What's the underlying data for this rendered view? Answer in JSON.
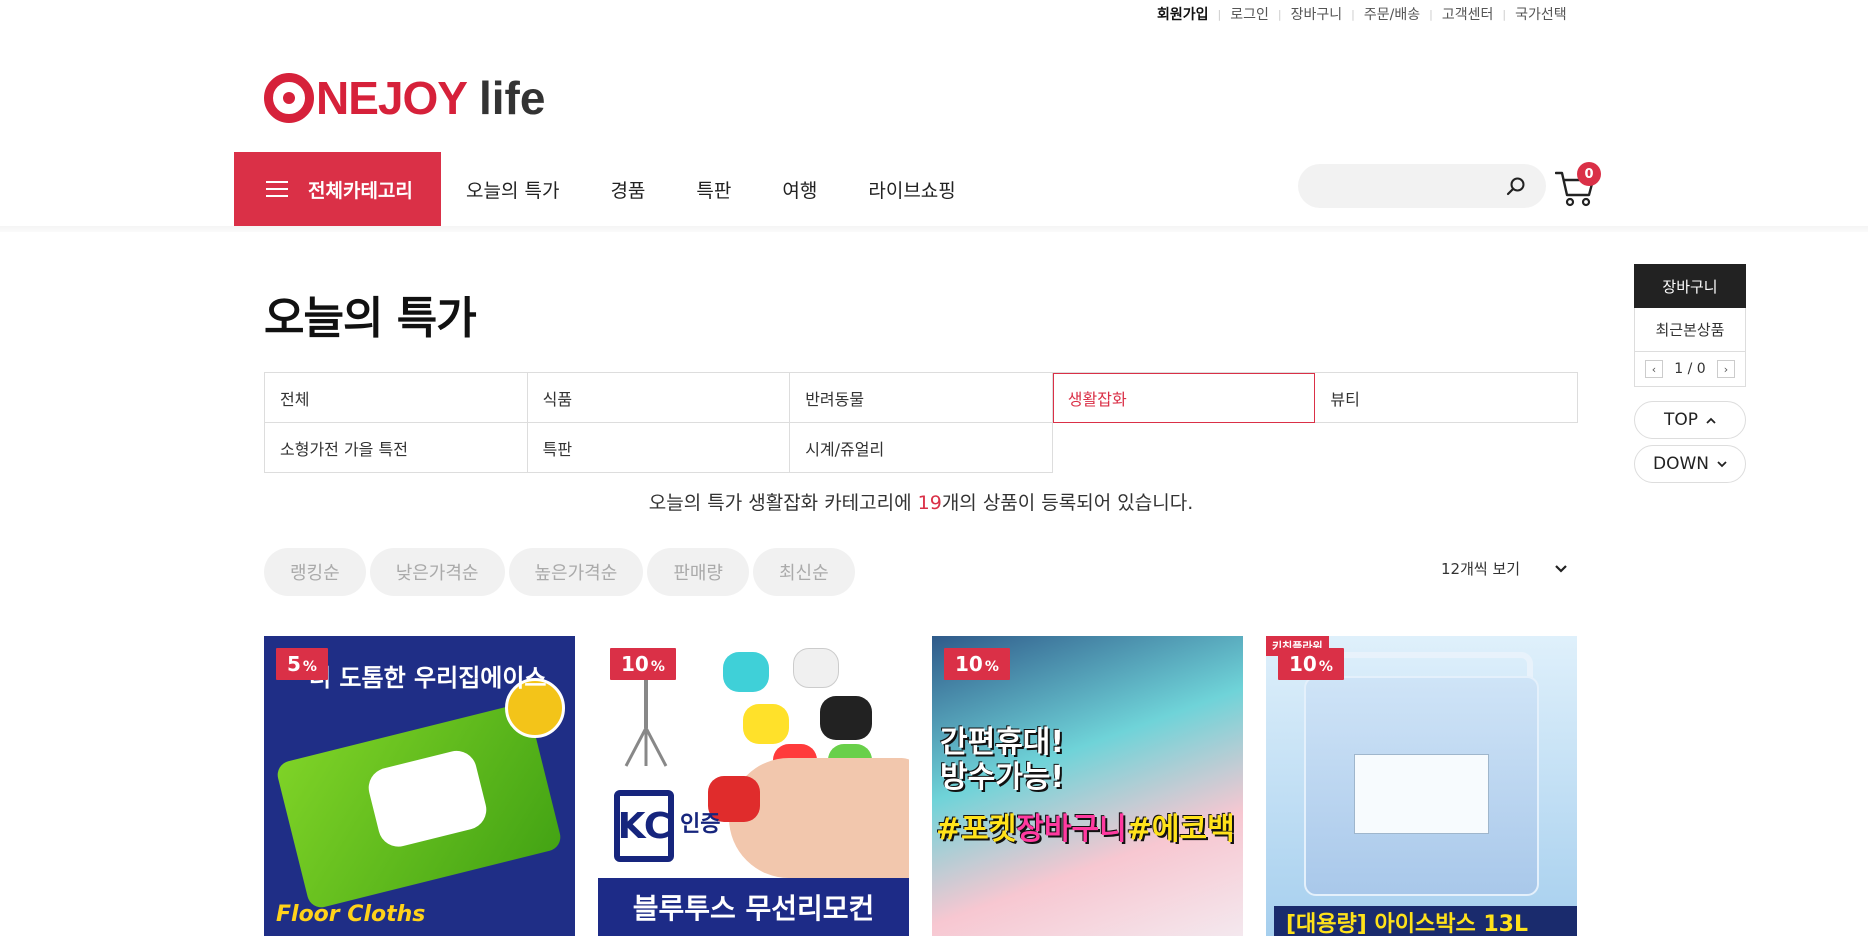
{
  "util": {
    "join": "회원가입",
    "login": "로그인",
    "cart": "장바구니",
    "order": "주문/배송",
    "cs": "고객센터",
    "country": "국가선택"
  },
  "logo": {
    "part1": "NEJOY",
    "part2": "life"
  },
  "gnb": {
    "all_category": "전체카테고리",
    "items": [
      "오늘의 특가",
      "경품",
      "특판",
      "여행",
      "라이브쇼핑"
    ]
  },
  "search": {
    "placeholder": ""
  },
  "cart_count": "0",
  "page_title": "오늘의 특가",
  "categories": [
    {
      "label": "전체",
      "active": false
    },
    {
      "label": "식품",
      "active": false
    },
    {
      "label": "반려동물",
      "active": false
    },
    {
      "label": "생활잡화",
      "active": true
    },
    {
      "label": "뷰티",
      "active": false
    },
    {
      "label": "소형가전 가을 특전",
      "active": false
    },
    {
      "label": "특판",
      "active": false
    },
    {
      "label": "시계/쥬얼리",
      "active": false
    }
  ],
  "count_line": {
    "before": "오늘의 특가 생활잡화 카테고리에 ",
    "num": "19",
    "after": "개의 상품이 등록되어 있습니다."
  },
  "sort": [
    "랭킹순",
    "낮은가격순",
    "높은가격순",
    "판매량",
    "최신순"
  ],
  "view_count": "12개씩 보기",
  "products": [
    {
      "discount": "5",
      "unit": "%",
      "banner": "더 도톰한 우리집에이스",
      "text": "Floor Cloths"
    },
    {
      "discount": "10",
      "unit": "%",
      "kc": "KC",
      "kc_text": "인증",
      "caption": "블루투스 무선리모컨"
    },
    {
      "discount": "10",
      "unit": "%",
      "headline1": "간편휴대!",
      "headline2": "방수가능!",
      "tag1": "#포켓",
      "tag2": "장바구니",
      "tag3": "#에코백"
    },
    {
      "discount": "10",
      "unit": "%",
      "brand": "키친플라워",
      "caption_a": "[대용량] ",
      "caption_b": "아이스박스 13L"
    }
  ],
  "quick": {
    "cart": "장바구니",
    "recent": "최근본상품",
    "pager": "1 / 0",
    "top": "TOP",
    "down": "DOWN"
  },
  "colors": {
    "accent": "#da3047",
    "navy": "#1d2b87"
  }
}
